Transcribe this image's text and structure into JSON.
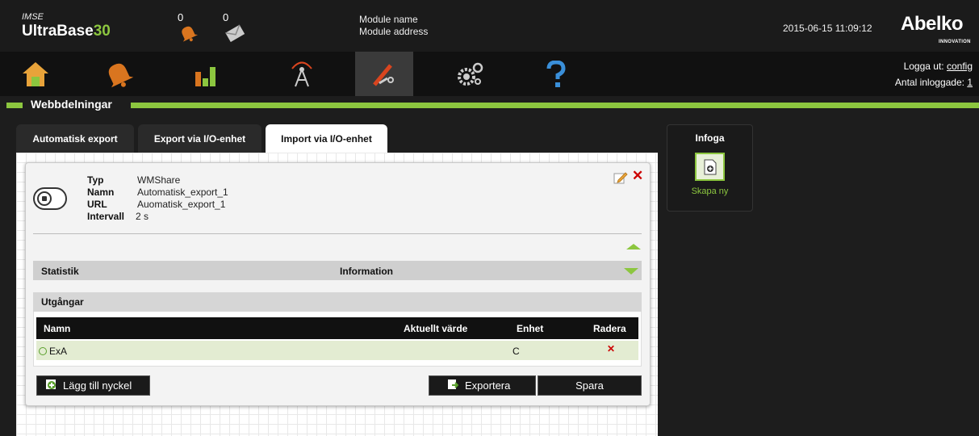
{
  "header": {
    "brand_small": "IMSE",
    "brand_name": "UltraBase",
    "brand_num": "30",
    "alarm_count": "0",
    "message_count": "0",
    "module_name": "Module name",
    "module_address": "Module address",
    "datetime": "2015-06-15 11:09:12",
    "logo": "Abelko",
    "logo_sub": "INNOVATION"
  },
  "nav": {
    "items": [
      "home-icon",
      "alarm-bell-icon",
      "bar-chart-icon",
      "radio-tower-icon",
      "tools-icon",
      "gears-icon",
      "help-icon"
    ],
    "active": "tools-icon",
    "logout_label": "Logga ut: ",
    "logout_user": "config",
    "logged_in_label": "Antal inloggade: ",
    "logged_in_count": "1"
  },
  "section": {
    "title": "Webbdelningar"
  },
  "tabs": [
    {
      "label": "Automatisk export",
      "active": false
    },
    {
      "label": "Export via I/O-enhet",
      "active": false
    },
    {
      "label": "Import via I/O-enhet",
      "active": true
    }
  ],
  "share": {
    "typ_label": "Typ",
    "typ_value": "WMShare",
    "namn_label": "Namn",
    "namn_value": "Automatisk_export_1",
    "url_label": "URL",
    "url_value": "Auomatisk_export_1",
    "intervall_label": "Intervall",
    "intervall_value": "2 s"
  },
  "statistik": {
    "label": "Statistik",
    "info_label": "Information"
  },
  "outputs": {
    "title": "Utgångar",
    "columns": {
      "name": "Namn",
      "value": "Aktuellt värde",
      "unit": "Enhet",
      "delete": "Radera"
    },
    "rows": [
      {
        "name": "ExA",
        "value": "",
        "unit": "C"
      }
    ]
  },
  "buttons": {
    "add_key": "Lägg till nyckel",
    "export": "Exportera",
    "save": "Spara"
  },
  "infoga": {
    "title": "Infoga",
    "create_label": "Skapa ny"
  },
  "colors": {
    "accent": "#8cc63f",
    "delete": "#cc0000",
    "background": "#1d1d1d"
  }
}
